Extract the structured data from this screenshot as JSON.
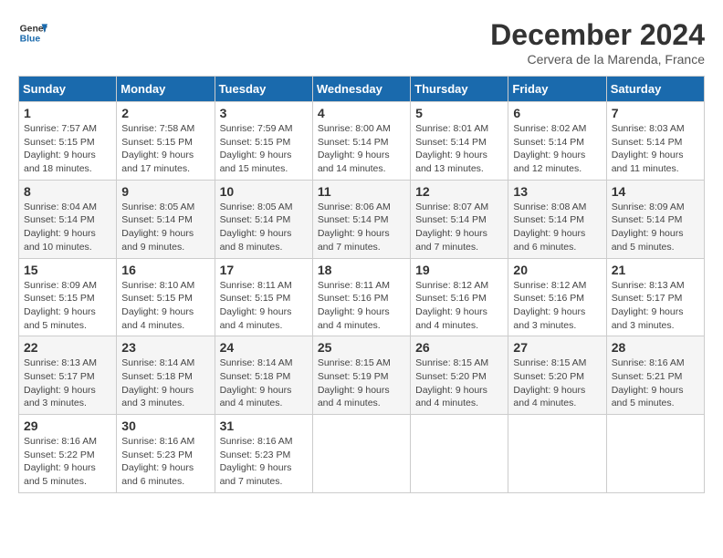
{
  "header": {
    "logo_line1": "General",
    "logo_line2": "Blue",
    "month_title": "December 2024",
    "location": "Cervera de la Marenda, France"
  },
  "weekdays": [
    "Sunday",
    "Monday",
    "Tuesday",
    "Wednesday",
    "Thursday",
    "Friday",
    "Saturday"
  ],
  "weeks": [
    [
      {
        "day": "1",
        "sunrise": "Sunrise: 7:57 AM",
        "sunset": "Sunset: 5:15 PM",
        "daylight": "Daylight: 9 hours and 18 minutes."
      },
      {
        "day": "2",
        "sunrise": "Sunrise: 7:58 AM",
        "sunset": "Sunset: 5:15 PM",
        "daylight": "Daylight: 9 hours and 17 minutes."
      },
      {
        "day": "3",
        "sunrise": "Sunrise: 7:59 AM",
        "sunset": "Sunset: 5:15 PM",
        "daylight": "Daylight: 9 hours and 15 minutes."
      },
      {
        "day": "4",
        "sunrise": "Sunrise: 8:00 AM",
        "sunset": "Sunset: 5:14 PM",
        "daylight": "Daylight: 9 hours and 14 minutes."
      },
      {
        "day": "5",
        "sunrise": "Sunrise: 8:01 AM",
        "sunset": "Sunset: 5:14 PM",
        "daylight": "Daylight: 9 hours and 13 minutes."
      },
      {
        "day": "6",
        "sunrise": "Sunrise: 8:02 AM",
        "sunset": "Sunset: 5:14 PM",
        "daylight": "Daylight: 9 hours and 12 minutes."
      },
      {
        "day": "7",
        "sunrise": "Sunrise: 8:03 AM",
        "sunset": "Sunset: 5:14 PM",
        "daylight": "Daylight: 9 hours and 11 minutes."
      }
    ],
    [
      {
        "day": "8",
        "sunrise": "Sunrise: 8:04 AM",
        "sunset": "Sunset: 5:14 PM",
        "daylight": "Daylight: 9 hours and 10 minutes."
      },
      {
        "day": "9",
        "sunrise": "Sunrise: 8:05 AM",
        "sunset": "Sunset: 5:14 PM",
        "daylight": "Daylight: 9 hours and 9 minutes."
      },
      {
        "day": "10",
        "sunrise": "Sunrise: 8:05 AM",
        "sunset": "Sunset: 5:14 PM",
        "daylight": "Daylight: 9 hours and 8 minutes."
      },
      {
        "day": "11",
        "sunrise": "Sunrise: 8:06 AM",
        "sunset": "Sunset: 5:14 PM",
        "daylight": "Daylight: 9 hours and 7 minutes."
      },
      {
        "day": "12",
        "sunrise": "Sunrise: 8:07 AM",
        "sunset": "Sunset: 5:14 PM",
        "daylight": "Daylight: 9 hours and 7 minutes."
      },
      {
        "day": "13",
        "sunrise": "Sunrise: 8:08 AM",
        "sunset": "Sunset: 5:14 PM",
        "daylight": "Daylight: 9 hours and 6 minutes."
      },
      {
        "day": "14",
        "sunrise": "Sunrise: 8:09 AM",
        "sunset": "Sunset: 5:14 PM",
        "daylight": "Daylight: 9 hours and 5 minutes."
      }
    ],
    [
      {
        "day": "15",
        "sunrise": "Sunrise: 8:09 AM",
        "sunset": "Sunset: 5:15 PM",
        "daylight": "Daylight: 9 hours and 5 minutes."
      },
      {
        "day": "16",
        "sunrise": "Sunrise: 8:10 AM",
        "sunset": "Sunset: 5:15 PM",
        "daylight": "Daylight: 9 hours and 4 minutes."
      },
      {
        "day": "17",
        "sunrise": "Sunrise: 8:11 AM",
        "sunset": "Sunset: 5:15 PM",
        "daylight": "Daylight: 9 hours and 4 minutes."
      },
      {
        "day": "18",
        "sunrise": "Sunrise: 8:11 AM",
        "sunset": "Sunset: 5:16 PM",
        "daylight": "Daylight: 9 hours and 4 minutes."
      },
      {
        "day": "19",
        "sunrise": "Sunrise: 8:12 AM",
        "sunset": "Sunset: 5:16 PM",
        "daylight": "Daylight: 9 hours and 4 minutes."
      },
      {
        "day": "20",
        "sunrise": "Sunrise: 8:12 AM",
        "sunset": "Sunset: 5:16 PM",
        "daylight": "Daylight: 9 hours and 3 minutes."
      },
      {
        "day": "21",
        "sunrise": "Sunrise: 8:13 AM",
        "sunset": "Sunset: 5:17 PM",
        "daylight": "Daylight: 9 hours and 3 minutes."
      }
    ],
    [
      {
        "day": "22",
        "sunrise": "Sunrise: 8:13 AM",
        "sunset": "Sunset: 5:17 PM",
        "daylight": "Daylight: 9 hours and 3 minutes."
      },
      {
        "day": "23",
        "sunrise": "Sunrise: 8:14 AM",
        "sunset": "Sunset: 5:18 PM",
        "daylight": "Daylight: 9 hours and 3 minutes."
      },
      {
        "day": "24",
        "sunrise": "Sunrise: 8:14 AM",
        "sunset": "Sunset: 5:18 PM",
        "daylight": "Daylight: 9 hours and 4 minutes."
      },
      {
        "day": "25",
        "sunrise": "Sunrise: 8:15 AM",
        "sunset": "Sunset: 5:19 PM",
        "daylight": "Daylight: 9 hours and 4 minutes."
      },
      {
        "day": "26",
        "sunrise": "Sunrise: 8:15 AM",
        "sunset": "Sunset: 5:20 PM",
        "daylight": "Daylight: 9 hours and 4 minutes."
      },
      {
        "day": "27",
        "sunrise": "Sunrise: 8:15 AM",
        "sunset": "Sunset: 5:20 PM",
        "daylight": "Daylight: 9 hours and 4 minutes."
      },
      {
        "day": "28",
        "sunrise": "Sunrise: 8:16 AM",
        "sunset": "Sunset: 5:21 PM",
        "daylight": "Daylight: 9 hours and 5 minutes."
      }
    ],
    [
      {
        "day": "29",
        "sunrise": "Sunrise: 8:16 AM",
        "sunset": "Sunset: 5:22 PM",
        "daylight": "Daylight: 9 hours and 5 minutes."
      },
      {
        "day": "30",
        "sunrise": "Sunrise: 8:16 AM",
        "sunset": "Sunset: 5:23 PM",
        "daylight": "Daylight: 9 hours and 6 minutes."
      },
      {
        "day": "31",
        "sunrise": "Sunrise: 8:16 AM",
        "sunset": "Sunset: 5:23 PM",
        "daylight": "Daylight: 9 hours and 7 minutes."
      },
      null,
      null,
      null,
      null
    ]
  ]
}
